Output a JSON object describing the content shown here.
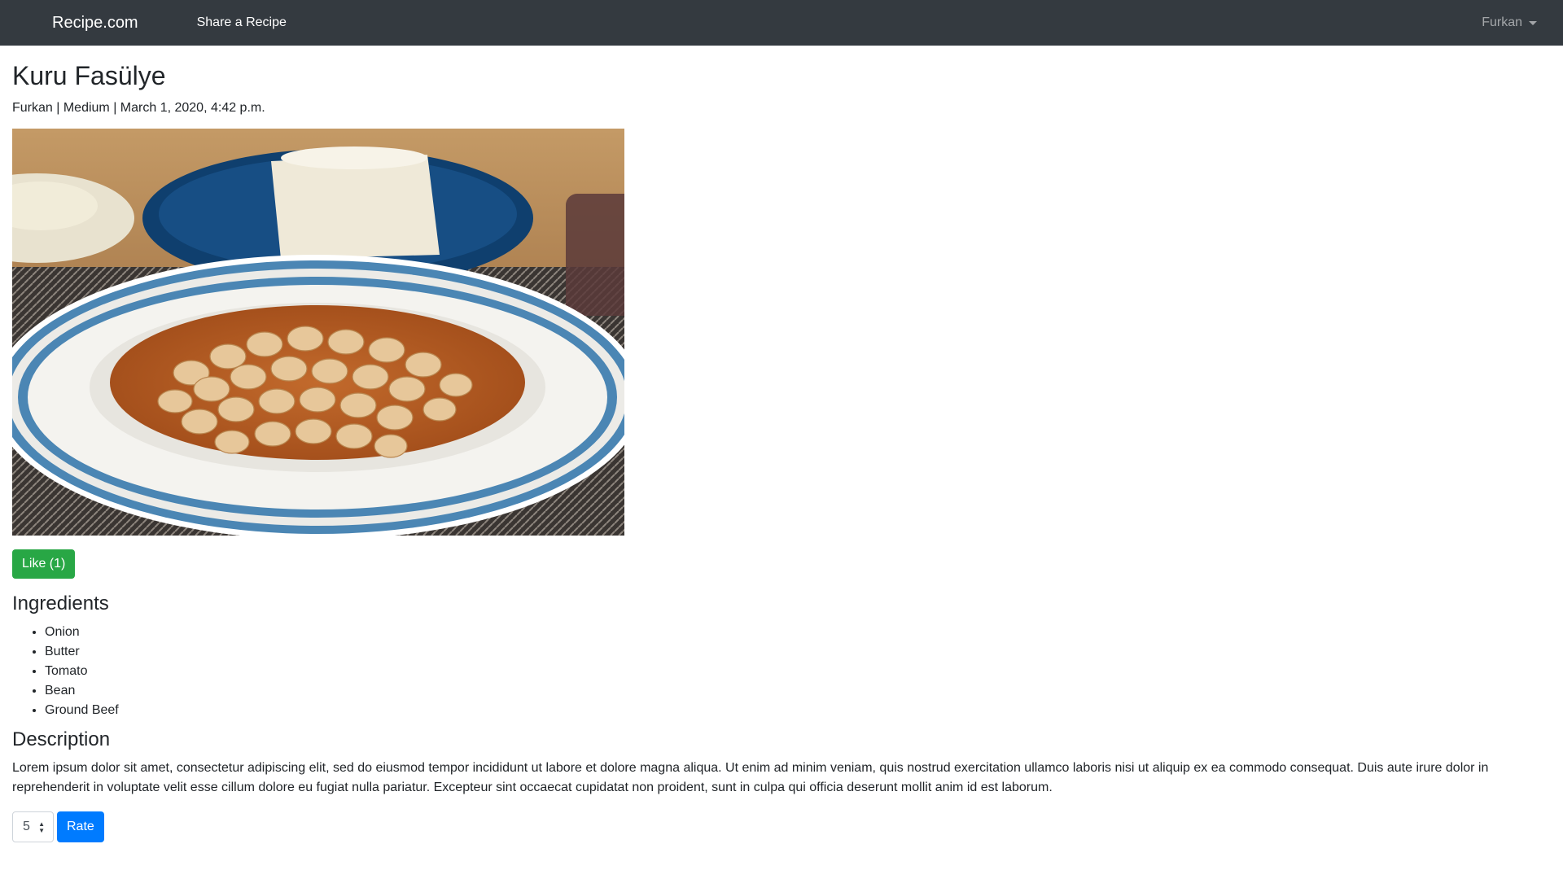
{
  "navbar": {
    "brand": "Recipe.com",
    "share_link": "Share a Recipe",
    "user": "Furkan"
  },
  "recipe": {
    "title": "Kuru Fasülye",
    "meta": "Furkan | Medium | March 1, 2020, 4:42 p.m.",
    "like_label": "Like (1)",
    "ingredients_heading": "Ingredients",
    "ingredients": [
      "Onion",
      "Butter",
      "Tomato",
      "Bean",
      "Ground Beef"
    ],
    "description_heading": "Description",
    "description": "Lorem ipsum dolor sit amet, consectetur adipiscing elit, sed do eiusmod tempor incididunt ut labore et dolore magna aliqua. Ut enim ad minim veniam, quis nostrud exercitation ullamco laboris nisi ut aliquip ex ea commodo consequat. Duis aute irure dolor in reprehenderit in voluptate velit esse cillum dolore eu fugiat nulla pariatur. Excepteur sint occaecat cupidatat non proident, sunt in culpa qui officia deserunt mollit anim id est laborum."
  },
  "rating": {
    "selected_value": "5",
    "rate_label": "Rate"
  },
  "colors": {
    "navbar": "#343a40",
    "like_button": "#28a745",
    "rate_button": "#007bff"
  }
}
